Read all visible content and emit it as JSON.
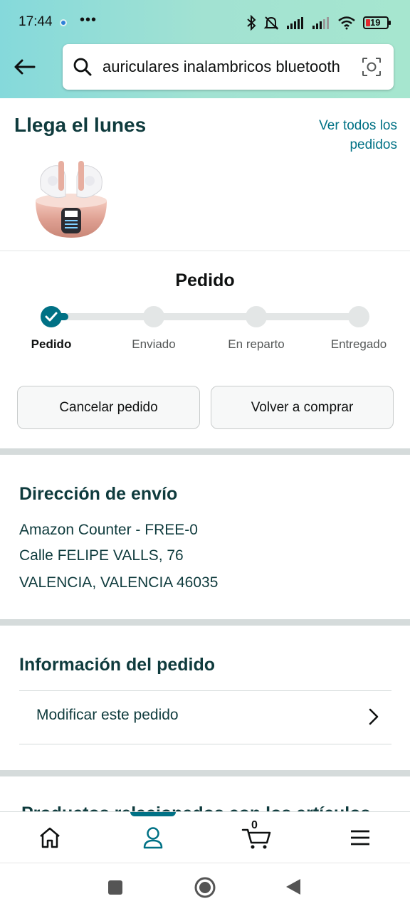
{
  "status_bar": {
    "time": "17:44",
    "more": "•••",
    "battery_level": "19"
  },
  "search": {
    "query": "auriculares inalambricos bluetooth"
  },
  "arrival": {
    "title": "Llega el lunes",
    "all_orders_link": "Ver todos los pedidos",
    "product_image": "Pink wireless earbuds in charging case"
  },
  "progress": {
    "title": "Pedido",
    "current_step": 1,
    "steps": [
      {
        "label": "Pedido"
      },
      {
        "label": "Enviado"
      },
      {
        "label": "En reparto"
      },
      {
        "label": "Entregado"
      }
    ]
  },
  "actions": {
    "cancel_label": "Cancelar pedido",
    "rebuy_label": "Volver a comprar"
  },
  "shipping": {
    "title": "Dirección de envío",
    "lines": [
      "Amazon Counter - FREE-0",
      "Calle FELIPE VALLS, 76",
      "VALENCIA, VALENCIA 46035"
    ]
  },
  "order_info": {
    "title": "Información del pedido",
    "modify_label": "Modificar este pedido"
  },
  "related": {
    "title": "Productos relacionados con los artículos"
  },
  "bottom_nav": {
    "items": [
      "home-icon",
      "account-icon",
      "cart-icon",
      "menu-icon"
    ],
    "active": "account-icon",
    "cart_count": "0"
  },
  "colors": {
    "accent": "#007185",
    "header_start": "#85d9db",
    "header_end": "#a6e6cf",
    "heading": "#0f3b3d"
  }
}
